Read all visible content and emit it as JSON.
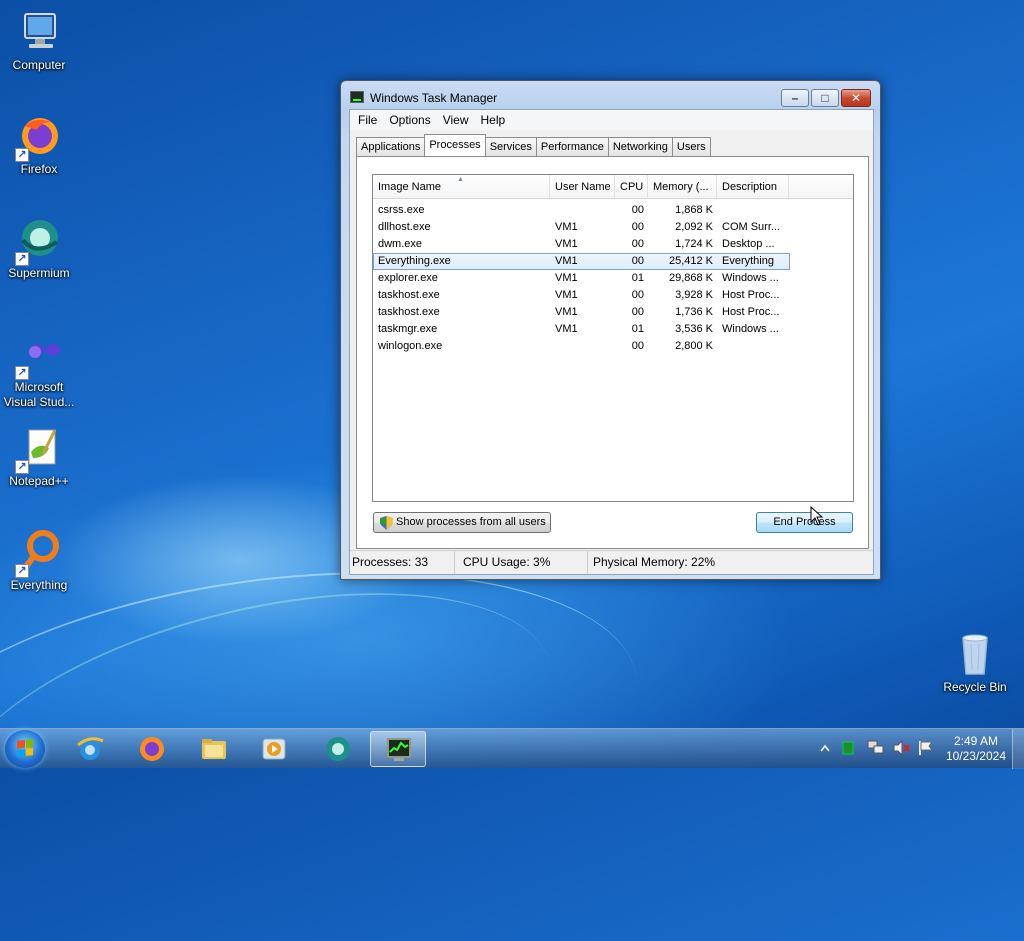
{
  "desktop": {
    "icons": [
      {
        "label": "Computer",
        "icon": "computer-icon"
      },
      {
        "label": "Firefox",
        "icon": "firefox-icon"
      },
      {
        "label": "Supermium",
        "icon": "supermium-icon"
      },
      {
        "label": "Microsoft Visual Stud...",
        "icon": "visual-studio-icon"
      },
      {
        "label": "Notepad++",
        "icon": "notepad-plus-plus-icon"
      },
      {
        "label": "Everything",
        "icon": "everything-icon"
      },
      {
        "label": "Recycle Bin",
        "icon": "recycle-bin-icon"
      }
    ]
  },
  "window": {
    "title": "Windows Task Manager",
    "controls": {
      "minimize": "–",
      "maximize": "□",
      "close": "✕"
    },
    "menu": [
      "File",
      "Options",
      "View",
      "Help"
    ],
    "tabs": [
      "Applications",
      "Processes",
      "Services",
      "Performance",
      "Networking",
      "Users"
    ],
    "active_tab": "Processes",
    "columns": [
      "Image Name",
      "User Name",
      "CPU",
      "Memory (...",
      "Description"
    ],
    "processes": [
      {
        "name": "csrss.exe",
        "user": "",
        "cpu": "00",
        "memory": "1,868 K",
        "description": ""
      },
      {
        "name": "dllhost.exe",
        "user": "VM1",
        "cpu": "00",
        "memory": "2,092 K",
        "description": "COM Surr..."
      },
      {
        "name": "dwm.exe",
        "user": "VM1",
        "cpu": "00",
        "memory": "1,724 K",
        "description": "Desktop ..."
      },
      {
        "name": "Everything.exe",
        "user": "VM1",
        "cpu": "00",
        "memory": "25,412 K",
        "description": "Everything"
      },
      {
        "name": "explorer.exe",
        "user": "VM1",
        "cpu": "01",
        "memory": "29,868 K",
        "description": "Windows ..."
      },
      {
        "name": "taskhost.exe",
        "user": "VM1",
        "cpu": "00",
        "memory": "3,928 K",
        "description": "Host Proc..."
      },
      {
        "name": "taskhost.exe",
        "user": "VM1",
        "cpu": "00",
        "memory": "1,736 K",
        "description": "Host Proc..."
      },
      {
        "name": "taskmgr.exe",
        "user": "VM1",
        "cpu": "01",
        "memory": "3,536 K",
        "description": "Windows ..."
      },
      {
        "name": "winlogon.exe",
        "user": "",
        "cpu": "00",
        "memory": "2,800 K",
        "description": ""
      }
    ],
    "selected_process": "Everything.exe",
    "buttons": {
      "show_all": "Show processes from all users",
      "end_process": "End Process"
    },
    "status": {
      "processes": "Processes: 33",
      "cpu": "CPU Usage: 3%",
      "memory": "Physical Memory: 22%"
    }
  },
  "taskbar": {
    "pinned": [
      "internet-explorer-icon",
      "firefox-icon",
      "file-explorer-icon",
      "media-player-icon",
      "supermium-icon",
      "task-manager-icon"
    ],
    "active": "task-manager-icon",
    "clock": {
      "time": "2:49 AM",
      "date": "10/23/2024"
    }
  },
  "colors": {
    "accent": "#3c7fb1",
    "selection": "#dcebfb",
    "desktop": "#1766c4"
  }
}
